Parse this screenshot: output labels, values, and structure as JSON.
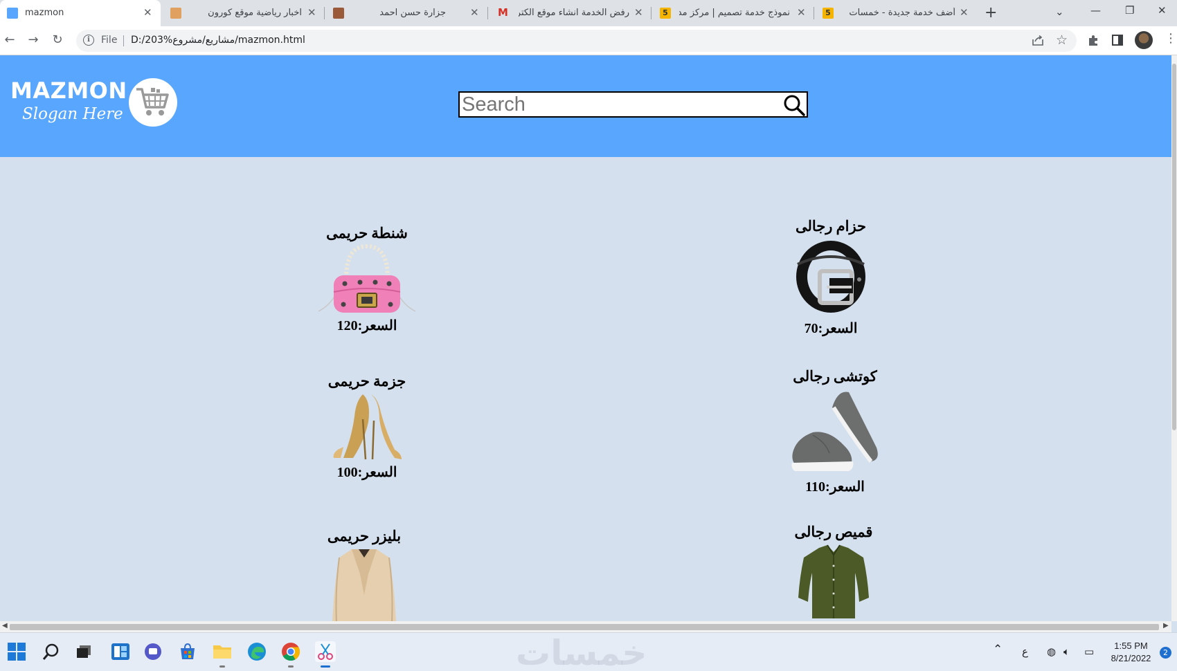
{
  "browser": {
    "tabs": [
      {
        "title": "mazmon",
        "active": true
      },
      {
        "title": "اخبار رياضية موقع كورون",
        "active": false
      },
      {
        "title": "جزارة حسن احمد",
        "active": false
      },
      {
        "title": "رفض الخدمة انشاء موقع الكتر",
        "active": false
      },
      {
        "title": "نموذج خدمة تصميم | مركز مد",
        "active": false
      },
      {
        "title": "أضف خدمة جديدة - خمسات",
        "active": false
      }
    ],
    "tab_badge": "5",
    "address_scheme": "File",
    "address_url": "D:/203%مشاريع/مشروع/mazmon.html"
  },
  "site": {
    "logo_text": "MAZMON",
    "slogan": "Slogan Here",
    "search_placeholder": "Search",
    "header_color": "#58a6fe",
    "background_color": "#d4e0ee"
  },
  "products": [
    {
      "name": "حزام رجالى",
      "price": "السعر:70",
      "image": "belt"
    },
    {
      "name": "شنطة حريمى",
      "price": "السعر:120",
      "image": "handbag"
    },
    {
      "name": "كوتشى رجالى",
      "price": "السعر:110",
      "image": "sneakers"
    },
    {
      "name": "جزمة حريمى",
      "price": "السعر:100",
      "image": "heels"
    },
    {
      "name": "قميص رجالى",
      "price": "",
      "image": "shirt"
    },
    {
      "name": "بليزر حريمى",
      "price": "",
      "image": "blazer"
    }
  ],
  "taskbar": {
    "apps": [
      "windows-start-icon",
      "search-icon",
      "task-view-icon",
      "widgets-icon",
      "teams-chat-icon",
      "store-icon",
      "file-explorer-icon",
      "edge-icon",
      "chrome-icon",
      "snipping-tool-icon"
    ],
    "language": "ع",
    "time": "1:55 PM",
    "date": "8/21/2022",
    "notifications": "2",
    "watermark": "خمسات"
  }
}
